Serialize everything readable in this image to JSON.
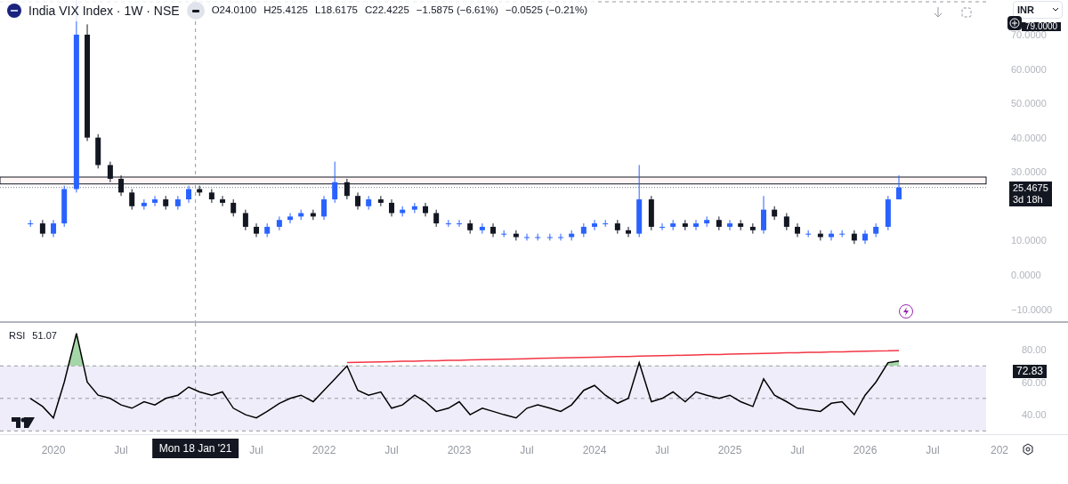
{
  "header": {
    "title": "India VIX Index · 1W · NSE",
    "ohlc": [
      "O24.0100",
      "H25.4125",
      "L18.6175",
      "C22.4225",
      "−1.5875 (−6.61%)",
      "−0.0525 (−0.21%)"
    ],
    "currency": "INR"
  },
  "price_chart": {
    "crosshair_price": "79.0000",
    "countdown": "3d 18h",
    "chart_data": {
      "type": "candlestick",
      "x": [
        2019.83,
        2019.92,
        2020,
        2020.08,
        2020.17,
        2020.25,
        2020.33,
        2020.42,
        2020.5,
        2020.58,
        2020.67,
        2020.75,
        2020.83,
        2020.92,
        2021,
        2021.08,
        2021.17,
        2021.25,
        2021.33,
        2021.42,
        2021.5,
        2021.58,
        2021.67,
        2021.75,
        2021.83,
        2021.92,
        2022,
        2022.08,
        2022.17,
        2022.25,
        2022.33,
        2022.42,
        2022.5,
        2022.58,
        2022.67,
        2022.75,
        2022.83,
        2022.92,
        2023,
        2023.08,
        2023.17,
        2023.25,
        2023.33,
        2023.42,
        2023.5,
        2023.58,
        2023.67,
        2023.75,
        2023.83,
        2023.92,
        2024,
        2024.08,
        2024.17,
        2024.25,
        2024.33,
        2024.42,
        2024.5,
        2024.58,
        2024.67,
        2024.75,
        2024.83,
        2024.92,
        2025,
        2025.08,
        2025.17,
        2025.25,
        2025.33,
        2025.42,
        2025.5,
        2025.58,
        2025.67,
        2025.75,
        2025.83,
        2025.92,
        2026,
        2026.08,
        2026.17,
        2026.25
      ],
      "ohlc": [
        [
          15,
          16,
          14,
          15
        ],
        [
          15,
          16,
          11,
          12
        ],
        [
          12,
          16,
          11,
          15
        ],
        [
          15,
          26,
          14,
          25
        ],
        [
          25,
          83,
          24,
          70
        ],
        [
          70,
          73,
          39,
          40
        ],
        [
          40,
          41,
          31,
          32
        ],
        [
          32,
          33,
          27,
          28
        ],
        [
          28,
          29,
          23,
          24
        ],
        [
          24,
          25,
          19,
          20
        ],
        [
          20,
          22,
          19,
          21
        ],
        [
          21,
          23,
          20,
          22
        ],
        [
          22,
          23,
          19,
          20
        ],
        [
          20,
          23,
          19,
          22
        ],
        [
          22,
          26,
          21,
          25
        ],
        [
          25,
          26,
          23,
          24
        ],
        [
          24,
          25,
          21,
          22
        ],
        [
          22,
          23,
          20,
          21
        ],
        [
          21,
          22,
          17,
          18
        ],
        [
          18,
          19,
          13,
          14
        ],
        [
          14,
          15,
          11,
          12
        ],
        [
          12,
          15,
          11,
          14
        ],
        [
          14,
          17,
          13,
          16
        ],
        [
          16,
          18,
          15,
          17
        ],
        [
          17,
          19,
          16,
          18
        ],
        [
          18,
          19,
          16,
          17
        ],
        [
          17,
          23,
          16,
          22
        ],
        [
          22,
          33,
          21,
          27
        ],
        [
          27,
          28,
          22,
          23
        ],
        [
          23,
          24,
          19,
          20
        ],
        [
          20,
          23,
          19,
          22
        ],
        [
          22,
          23,
          20,
          21
        ],
        [
          21,
          22,
          17,
          18
        ],
        [
          18,
          20,
          17,
          19
        ],
        [
          19,
          21,
          18,
          20
        ],
        [
          20,
          21,
          17,
          18
        ],
        [
          18,
          19,
          14,
          15
        ],
        [
          15,
          16,
          14,
          15
        ],
        [
          15,
          16,
          14,
          15
        ],
        [
          15,
          16,
          12,
          13
        ],
        [
          13,
          15,
          12,
          14
        ],
        [
          14,
          15,
          11,
          12
        ],
        [
          12,
          13,
          11,
          12
        ],
        [
          12,
          13,
          10,
          11
        ],
        [
          11,
          12,
          10,
          11
        ],
        [
          11,
          12,
          10,
          11
        ],
        [
          11,
          12,
          10,
          11
        ],
        [
          11,
          12,
          10,
          11
        ],
        [
          11,
          13,
          10,
          12
        ],
        [
          12,
          15,
          11,
          14
        ],
        [
          14,
          16,
          13,
          15
        ],
        [
          15,
          16,
          14,
          15
        ],
        [
          15,
          16,
          12,
          13
        ],
        [
          13,
          14,
          11,
          12
        ],
        [
          12,
          32,
          11,
          22
        ],
        [
          22,
          23,
          13,
          14
        ],
        [
          14,
          15,
          13,
          14
        ],
        [
          14,
          16,
          13,
          15
        ],
        [
          15,
          16,
          13,
          14
        ],
        [
          14,
          16,
          13,
          15
        ],
        [
          15,
          17,
          14,
          16
        ],
        [
          16,
          17,
          13,
          14
        ],
        [
          14,
          16,
          13,
          15
        ],
        [
          15,
          16,
          13,
          14
        ],
        [
          14,
          15,
          12,
          13
        ],
        [
          13,
          23,
          12,
          19
        ],
        [
          19,
          20,
          16,
          17
        ],
        [
          17,
          18,
          13,
          14
        ],
        [
          14,
          15,
          11,
          12
        ],
        [
          12,
          13,
          11,
          12
        ],
        [
          12,
          13,
          10,
          11
        ],
        [
          11,
          13,
          10,
          12
        ],
        [
          12,
          13,
          11,
          12
        ],
        [
          12,
          13,
          9,
          10
        ],
        [
          10,
          13,
          9,
          12
        ],
        [
          12,
          15,
          11,
          14
        ],
        [
          14,
          23,
          13,
          22
        ],
        [
          22,
          29,
          22,
          25.47
        ]
      ],
      "xlim": [
        2019.605,
        2027.5
      ],
      "ylim": [
        -13.5,
        80.1
      ],
      "yticks": [
        {
          "value": 70,
          "label": "70.0000"
        },
        {
          "value": 60,
          "label": "60.0000"
        },
        {
          "value": 50,
          "label": "50.0000"
        },
        {
          "value": 40,
          "label": "40.0000"
        },
        {
          "value": 30,
          "label": "30.0000"
        },
        {
          "value": 10,
          "label": "10.0000"
        },
        {
          "value": 0,
          "label": "0.0000"
        },
        {
          "value": -10,
          "label": "−10.0000"
        }
      ],
      "ref_lines": [
        {
          "axis": "y",
          "value": 25.4675,
          "label": "25.4675"
        },
        {
          "axis": "x",
          "value": 2021.05
        }
      ],
      "bands": [
        {
          "axis": "y",
          "from": 26.5,
          "to": 28.5
        }
      ]
    }
  },
  "rsi_chart": {
    "label": "RSI",
    "reading": "51.07",
    "last_value": "72.83",
    "chart_data": {
      "type": "line",
      "x": [
        2019.83,
        2019.92,
        2020,
        2020.08,
        2020.17,
        2020.25,
        2020.33,
        2020.42,
        2020.5,
        2020.58,
        2020.67,
        2020.75,
        2020.83,
        2020.92,
        2021,
        2021.08,
        2021.17,
        2021.25,
        2021.33,
        2021.42,
        2021.5,
        2021.58,
        2021.67,
        2021.75,
        2021.83,
        2021.92,
        2022,
        2022.08,
        2022.17,
        2022.25,
        2022.33,
        2022.42,
        2022.5,
        2022.58,
        2022.67,
        2022.75,
        2022.83,
        2022.92,
        2023,
        2023.08,
        2023.17,
        2023.25,
        2023.33,
        2023.42,
        2023.5,
        2023.58,
        2023.67,
        2023.75,
        2023.83,
        2023.92,
        2024,
        2024.08,
        2024.17,
        2024.25,
        2024.33,
        2024.42,
        2024.5,
        2024.58,
        2024.67,
        2024.75,
        2024.83,
        2024.92,
        2025,
        2025.08,
        2025.17,
        2025.25,
        2025.33,
        2025.42,
        2025.5,
        2025.58,
        2025.67,
        2025.75,
        2025.83,
        2025.92,
        2026,
        2026.08,
        2026.17,
        2026.25
      ],
      "series": [
        {
          "color": "#f23645",
          "values": [
            null,
            null,
            null,
            null,
            null,
            null,
            null,
            null,
            null,
            null,
            null,
            null,
            null,
            null,
            null,
            null,
            null,
            null,
            null,
            null,
            null,
            null,
            null,
            null,
            null,
            null,
            null,
            null,
            72.0,
            72.2,
            72.3,
            72.5,
            72.6,
            72.8,
            72.9,
            73.1,
            73.2,
            73.4,
            73.5,
            73.7,
            73.8,
            74.0,
            74.1,
            74.3,
            74.4,
            74.6,
            74.8,
            74.9,
            75.1,
            75.2,
            75.4,
            75.5,
            75.7,
            75.8,
            76.0,
            76.1,
            76.3,
            76.4,
            76.6,
            76.7,
            76.9,
            77.0,
            77.2,
            77.4,
            77.5,
            77.7,
            77.8,
            78.0,
            78.1,
            78.3,
            78.4,
            78.6,
            78.7,
            78.9,
            79.0,
            79.2,
            79.3,
            79.5
          ]
        },
        {
          "color": "#000000",
          "values": [
            50,
            45,
            38,
            60,
            90,
            60,
            52,
            50,
            46,
            44,
            48,
            46,
            50,
            52,
            57,
            54,
            52,
            54,
            44,
            40,
            38,
            42,
            47,
            50,
            52,
            48,
            55,
            62,
            70,
            55,
            52,
            54,
            44,
            46,
            52,
            48,
            42,
            44,
            48,
            40,
            44,
            42,
            40,
            38,
            44,
            46,
            44,
            42,
            46,
            55,
            58,
            52,
            47,
            50,
            72,
            48,
            50,
            54,
            48,
            54,
            52,
            50,
            52,
            48,
            45,
            62,
            52,
            48,
            44,
            43,
            42,
            47,
            48,
            40,
            52,
            60,
            72,
            73
          ]
        }
      ],
      "xlim": [
        2019.605,
        2027.5
      ],
      "ylim": [
        -2.63,
        96.4
      ],
      "ref_lines": [
        {
          "axis": "y",
          "value": 70
        },
        {
          "axis": "y",
          "value": 50
        },
        {
          "axis": "y",
          "value": 30
        },
        {
          "axis": "x",
          "value": 2021.05
        }
      ],
      "bands": [
        {
          "axis": "y",
          "from": 30,
          "to": 70
        }
      ],
      "xticks": [
        {
          "value": 2020,
          "label": "2020"
        },
        {
          "value": 2020.5,
          "label": "Jul"
        },
        {
          "value": 2021.5,
          "label": "Jul"
        },
        {
          "value": 2022,
          "label": "2022"
        },
        {
          "value": 2022.5,
          "label": "Jul"
        },
        {
          "value": 2023,
          "label": "2023"
        },
        {
          "value": 2023.5,
          "label": "Jul"
        },
        {
          "value": 2024,
          "label": "2024"
        },
        {
          "value": 2024.5,
          "label": "Jul"
        },
        {
          "value": 2025,
          "label": "2025"
        },
        {
          "value": 2025.5,
          "label": "Jul"
        },
        {
          "value": 2026,
          "label": "2026"
        },
        {
          "value": 2026.5,
          "label": "Jul"
        }
      ],
      "yticks": [
        {
          "value": 80,
          "label": "80.00"
        },
        {
          "value": 60,
          "label": "60.00"
        },
        {
          "value": 40,
          "label": "40.00"
        }
      ]
    }
  },
  "time_axis": {
    "crosshair_label": "Mon 18 Jan '21",
    "edge_label": "202"
  }
}
